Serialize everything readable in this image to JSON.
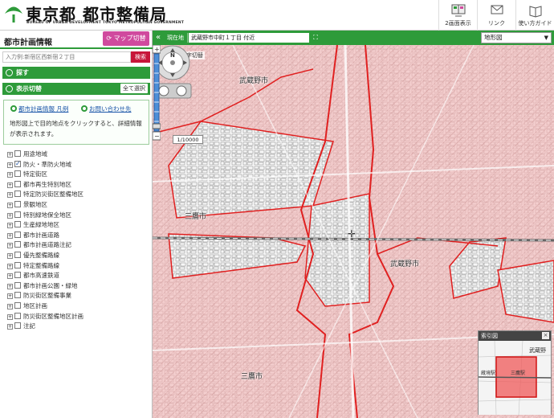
{
  "header": {
    "brand_ja": "東京都 都市整備局",
    "brand_en": "BUREAU OF URBAN DEVELOPMENT TOKYO METROPOLITAN GOVERNMENT",
    "buttons": [
      {
        "label": "2画面表示",
        "icon": "dual-screen-icon"
      },
      {
        "label": "リンク",
        "icon": "link-icon"
      },
      {
        "label": "使い方ガイド",
        "icon": "guide-icon"
      }
    ]
  },
  "left_panel": {
    "title": "都市計画情報",
    "map_switch": "マップ切替",
    "search": {
      "placeholder": "入力例:新宿区西新宿２丁目",
      "button": "検索"
    },
    "find_bar": "探す",
    "display_bar": "表示切替",
    "select_all": "全て選択",
    "info_links": [
      "都市計画情報 凡例",
      "お問い合わせ先"
    ],
    "info_text": "地形図上で目的地点をクリックすると、詳細情報が表示されます。",
    "layers": [
      {
        "label": "用途地域",
        "checked": false
      },
      {
        "label": "防火・準防火地域",
        "checked": true
      },
      {
        "label": "特定街区",
        "checked": false
      },
      {
        "label": "都市再生特別地区",
        "checked": false
      },
      {
        "label": "特定防災街区整備地区",
        "checked": false
      },
      {
        "label": "景観地区",
        "checked": false
      },
      {
        "label": "特別緑地保全地区",
        "checked": false
      },
      {
        "label": "生産緑地地区",
        "checked": false
      },
      {
        "label": "都市計画道路",
        "checked": false
      },
      {
        "label": "都市計画道路注記",
        "checked": false
      },
      {
        "label": "優先整備路線",
        "checked": false
      },
      {
        "label": "特定整備路線",
        "checked": false
      },
      {
        "label": "都市高速鉄道",
        "checked": false
      },
      {
        "label": "都市計画公園・緑地",
        "checked": false
      },
      {
        "label": "防災街区整備事業",
        "checked": false
      },
      {
        "label": "地区計画",
        "checked": false
      },
      {
        "label": "防災街区整備地区計画",
        "checked": false
      },
      {
        "label": "注記",
        "checked": false
      }
    ]
  },
  "toolbar": {
    "collapse": "«",
    "location_label": "現在地",
    "address": "武蔵野市中町１丁目 付近",
    "map_type": "地形図"
  },
  "map": {
    "crosshair_label": "中心十字切替",
    "scale": "1/10000",
    "labels": [
      "武蔵野市",
      "三鷹市",
      "武蔵野市",
      "三鷹市"
    ],
    "index_map": {
      "title": "索引図",
      "close": "×",
      "labels": [
        "武蔵野",
        "蔵境駅",
        "三鷹駅"
      ]
    },
    "colors": {
      "zone_fill": "#f2c6c6",
      "boundary": "#e02020",
      "hatch": "#c98a8a"
    }
  }
}
